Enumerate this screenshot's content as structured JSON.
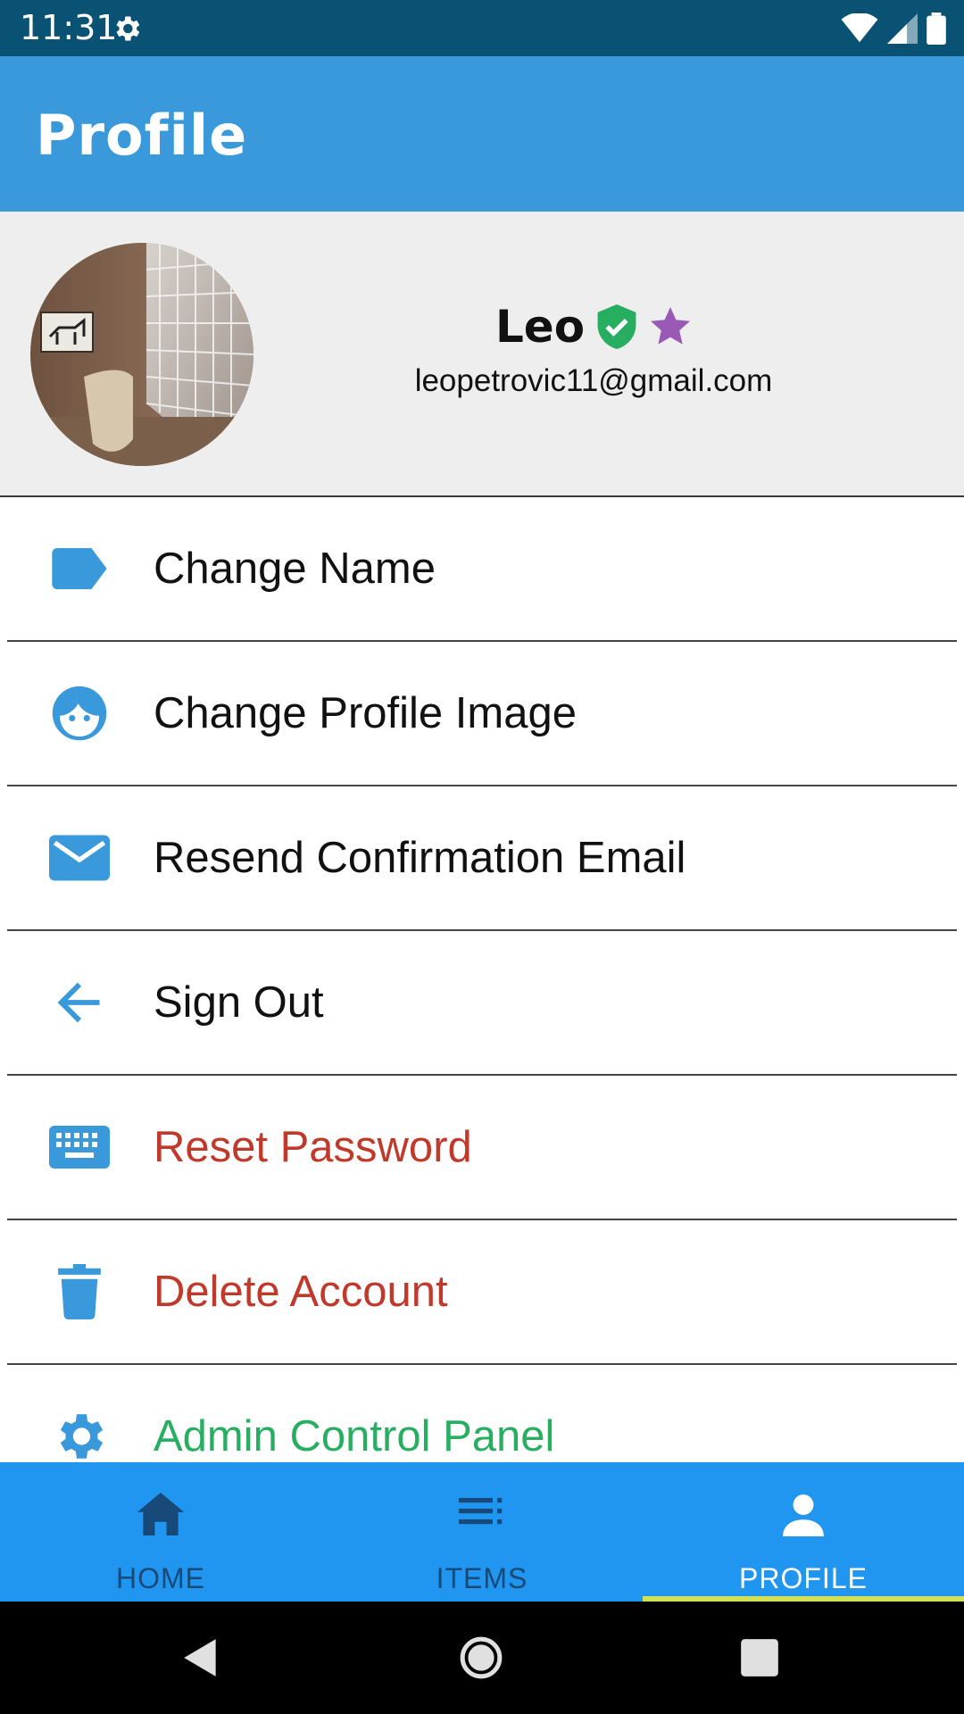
{
  "status_bar": {
    "time": "11:31",
    "icons": [
      "settings-gear-icon",
      "wifi-icon",
      "signal-icon",
      "battery-icon"
    ]
  },
  "app_bar": {
    "title": "Profile",
    "color": "#3a99db"
  },
  "profile": {
    "name": "Leo",
    "email": "leopetrovic11@gmail.com",
    "badges": [
      "verified-shield-icon",
      "star-icon"
    ],
    "badge_colors": {
      "shield": "#27ae60",
      "star": "#9b59b6"
    }
  },
  "menu": {
    "items": [
      {
        "label": "Change Name",
        "icon": "label-tag-icon",
        "color": "#111111"
      },
      {
        "label": "Change Profile Image",
        "icon": "face-icon",
        "color": "#111111"
      },
      {
        "label": "Resend Confirmation Email",
        "icon": "envelope-icon",
        "color": "#111111"
      },
      {
        "label": "Sign Out",
        "icon": "arrow-left-icon",
        "color": "#111111"
      },
      {
        "label": "Reset Password",
        "icon": "keyboard-icon",
        "color": "#c0392b"
      },
      {
        "label": "Delete Account",
        "icon": "trash-icon",
        "color": "#c0392b"
      },
      {
        "label": "Admin Control Panel",
        "icon": "gear-icon",
        "color": "#27ae60"
      }
    ],
    "icon_color": "#3a99db"
  },
  "bottom_nav": {
    "tabs": [
      {
        "label": "HOME",
        "icon": "home-icon",
        "active": false
      },
      {
        "label": "ITEMS",
        "icon": "list-icon",
        "active": false
      },
      {
        "label": "PROFILE",
        "icon": "person-icon",
        "active": true
      }
    ],
    "background": "#2196f0",
    "indicator_color": "#d4e157"
  },
  "system_nav": {
    "buttons": [
      "back-triangle-icon",
      "home-circle-icon",
      "recents-square-icon"
    ]
  }
}
